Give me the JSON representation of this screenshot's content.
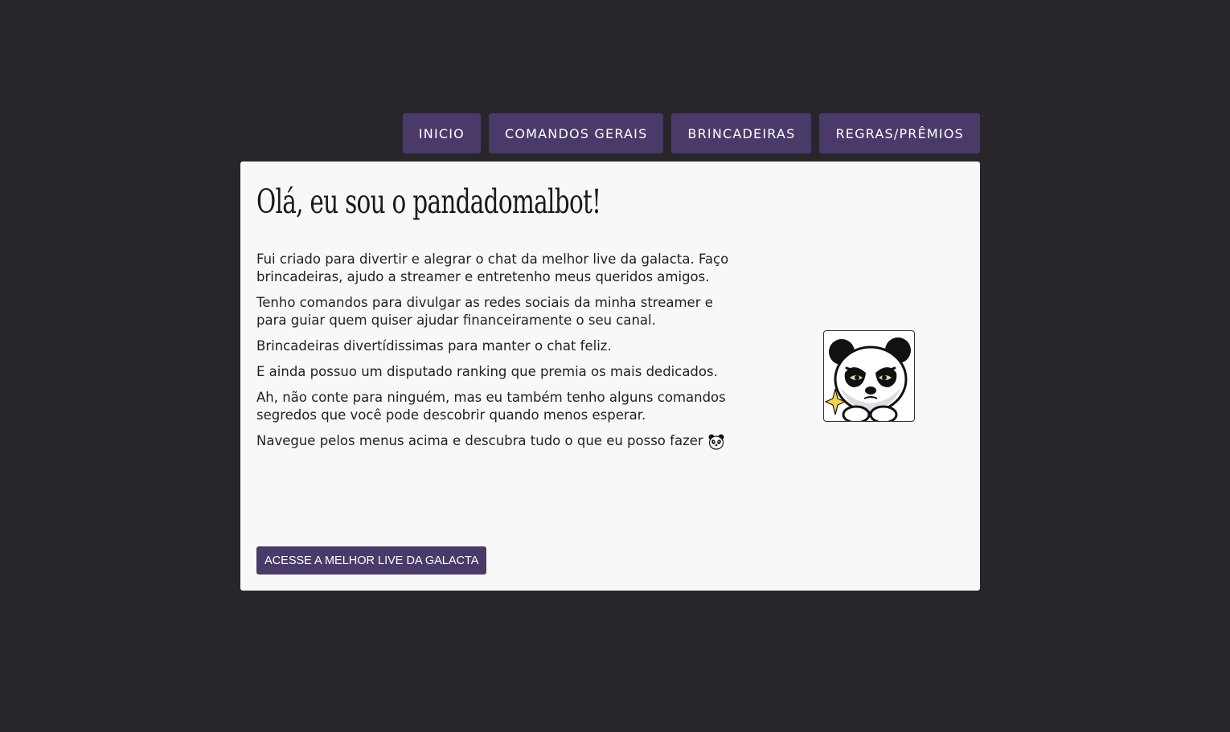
{
  "nav": {
    "items": [
      {
        "label": "INICIO"
      },
      {
        "label": "COMANDOS GERAIS"
      },
      {
        "label": "BRINCADEIRAS"
      },
      {
        "label": "REGRAS/PRÊMIOS"
      }
    ]
  },
  "main": {
    "title": "Olá, eu sou o pandadomalbot!",
    "paragraphs": [
      "Fui criado para divertir e alegrar o chat da melhor live da galacta. Faço brincadeiras, ajudo a streamer e entretenho meus queridos amigos.",
      "Tenho comandos para divulgar as redes sociais da minha streamer e para guiar quem quiser ajudar financeiramente o seu canal.",
      "Brincadeiras divertídissimas para manter o chat feliz.",
      "E ainda possuo um disputado ranking que premia os mais dedicados.",
      "Ah, não conte para ninguém, mas eu também tenho alguns comandos segredos que você pode descobrir quando menos esperar.",
      "Navegue pelos menus acima e descubra tudo o que eu posso fazer"
    ],
    "cta_label": "ACESSE A MELHOR LIVE DA GALACTA",
    "inline_icon": "panda-face-icon",
    "avatar_icon": "panda-avatar-icon"
  },
  "colors": {
    "background": "#28262a",
    "accent": "#4a3a6a",
    "card": "#f8f8f8"
  }
}
